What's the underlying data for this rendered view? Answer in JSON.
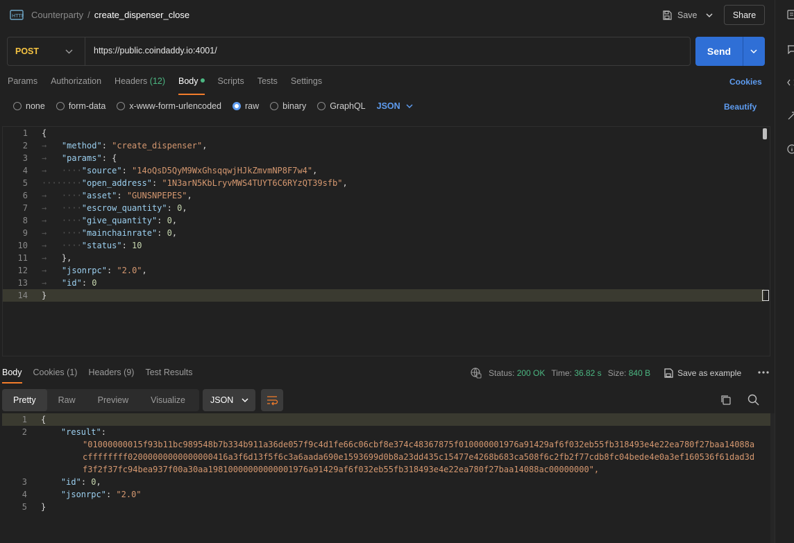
{
  "header": {
    "breadcrumb_parent": "Counterparty",
    "breadcrumb_sep": "/",
    "title": "create_dispenser_close",
    "save_label": "Save",
    "share_label": "Share"
  },
  "request": {
    "method": "POST",
    "url": "https://public.coindaddy.io:4001/",
    "send_label": "Send"
  },
  "tabs": {
    "params": "Params",
    "authorization": "Authorization",
    "headers": "Headers",
    "headers_count": "(12)",
    "body": "Body",
    "scripts": "Scripts",
    "tests": "Tests",
    "settings": "Settings",
    "cookies": "Cookies"
  },
  "body_options": {
    "none": "none",
    "form_data": "form-data",
    "urlencoded": "x-www-form-urlencoded",
    "raw": "raw",
    "binary": "binary",
    "graphql": "GraphQL",
    "language": "JSON",
    "beautify": "Beautify"
  },
  "editor": {
    "line_numbers": [
      "1",
      "2",
      "3",
      "4",
      "5",
      "6",
      "7",
      "8",
      "9",
      "10",
      "11",
      "12",
      "13",
      "14"
    ],
    "method_key": "\"method\"",
    "method_val": "\"create_dispenser\"",
    "params_key": "\"params\"",
    "source_key": "\"source\"",
    "source_val": "\"14oQsD5QyM9WxGhsqqwjHJkZmvmNP8F7w4\"",
    "open_address_key": "\"open_address\"",
    "open_address_val": "\"1N3arN5KbLryvMWS4TUYT6C6RYzQT39sfb\"",
    "asset_key": "\"asset\"",
    "asset_val": "\"GUNSNPEPES\"",
    "escrow_key": "\"escrow_quantity\"",
    "escrow_val": "0",
    "give_key": "\"give_quantity\"",
    "give_val": "0",
    "rate_key": "\"mainchainrate\"",
    "rate_val": "0",
    "status_key": "\"status\"",
    "status_val": "10",
    "jsonrpc_key": "\"jsonrpc\"",
    "jsonrpc_val": "\"2.0\"",
    "id_key": "\"id\"",
    "id_val": "0"
  },
  "response": {
    "tabs": {
      "body": "Body",
      "cookies": "Cookies",
      "cookies_count": "(1)",
      "headers": "Headers",
      "headers_count": "(9)",
      "tests": "Test Results"
    },
    "status_label": "Status:",
    "status_value": "200 OK",
    "time_label": "Time:",
    "time_value": "36.82 s",
    "size_label": "Size:",
    "size_value": "840 B",
    "save_example": "Save as example",
    "views": {
      "pretty": "Pretty",
      "raw": "Raw",
      "preview": "Preview",
      "visualize": "Visualize"
    },
    "format": "JSON",
    "line_numbers": [
      "1",
      "2",
      "3",
      "4",
      "5"
    ],
    "result_key": "\"result\"",
    "result_val": "\"01000000015f93b11bc989548b7b334b911a36de057f9c4d1fe66c06cbf8e374c48367875f010000001976a91429af6f032eb55fb318493e4e22ea780f27baa14088acffffffff02000000000000000416a3f6d13f5f6c3a6aada690e1593699d0b8a23dd435c15477e4268b683ca508f6c2fb2f77cdb8fc04bede4e0a3ef160536f61dad3df3f2f37fc94bea937f00a30aa19810000000000001976a91429af6f032eb55fb318493e4e22ea780f27baa14088ac00000000\"",
    "id_key": "\"id\"",
    "id_val": "0",
    "jsonrpc_key": "\"jsonrpc\"",
    "jsonrpc_val": "\"2.0\""
  },
  "colors": {
    "accent": "#2f6fd6",
    "link": "#5e9cf0",
    "active_tab": "#f37c2b",
    "method": "#f5c342",
    "success": "#4cb782"
  }
}
